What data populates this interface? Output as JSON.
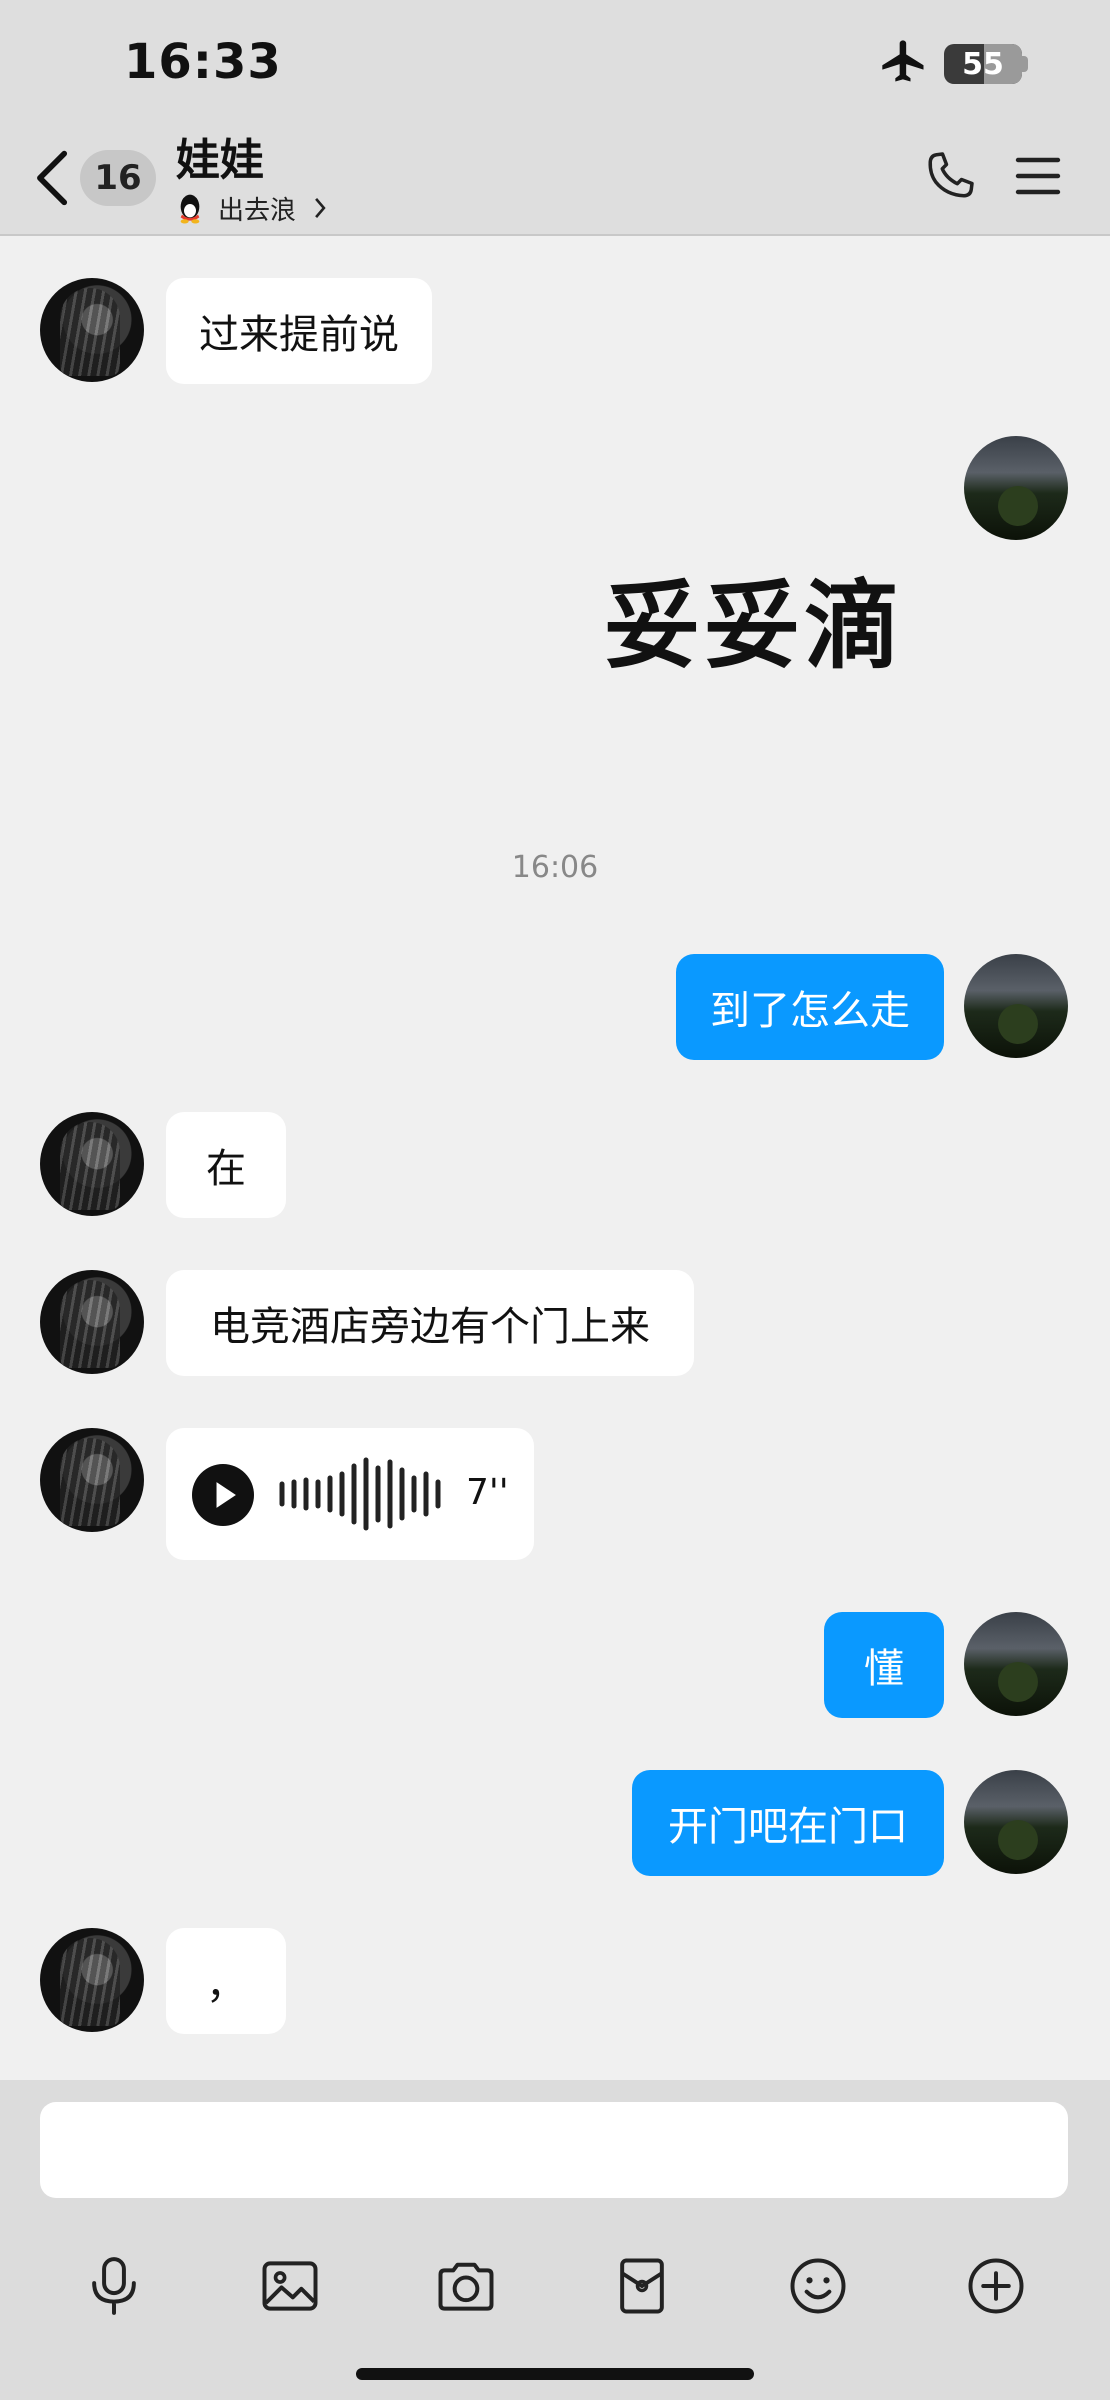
{
  "status_bar": {
    "time": "16:33",
    "battery": "55"
  },
  "header": {
    "unread_count": "16",
    "contact_name": "娃娃",
    "contact_status": "出去浪"
  },
  "messages": [
    {
      "side": "in",
      "type": "text",
      "text": "过来提前说"
    },
    {
      "side": "out",
      "type": "sticker",
      "text": "妥妥滴"
    },
    {
      "type": "time",
      "text": "16:06"
    },
    {
      "side": "out",
      "type": "text",
      "text": "到了怎么走"
    },
    {
      "side": "in",
      "type": "text",
      "text": "在"
    },
    {
      "side": "in",
      "type": "text",
      "text": "电竞酒店旁边有个门上来"
    },
    {
      "side": "in",
      "type": "voice",
      "duration": "7''"
    },
    {
      "side": "out",
      "type": "text",
      "text": "懂"
    },
    {
      "side": "out",
      "type": "text",
      "text": "开门吧在门口"
    },
    {
      "side": "in",
      "type": "text",
      "text": "，"
    }
  ],
  "input": {
    "value": "",
    "placeholder": ""
  },
  "toolbar": {
    "icons": [
      "microphone-icon",
      "image-icon",
      "camera-icon",
      "red-packet-icon",
      "emoji-icon",
      "plus-icon"
    ]
  },
  "colors": {
    "outgoing_bubble": "#0a99ff",
    "incoming_bubble": "#ffffff",
    "background": "#f0f0f0"
  }
}
